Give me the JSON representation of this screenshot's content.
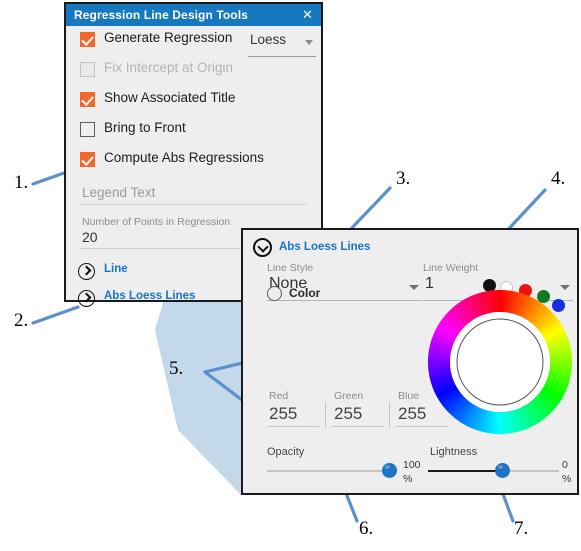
{
  "panel1": {
    "title": "Regression Line Design Tools",
    "close_icon": "close-icon",
    "checkboxes": [
      {
        "label": "Generate Regression",
        "checked": true,
        "disabled": false
      },
      {
        "label": "Fix Intercept at Origin",
        "checked": false,
        "disabled": true
      },
      {
        "label": "Show Associated Title",
        "checked": true,
        "disabled": false
      },
      {
        "label": "Bring to Front",
        "checked": false,
        "disabled": false
      },
      {
        "label": "Compute Abs Regressions",
        "checked": true,
        "disabled": false
      }
    ],
    "regression_type": {
      "value": "Loess",
      "caret_icon": "chevron-down-icon"
    },
    "legend_text": {
      "placeholder": "Legend Text",
      "value": ""
    },
    "num_points": {
      "label": "Number of Points in Regression",
      "value": "20"
    },
    "expanders": [
      {
        "label": "Line",
        "icon": "chevron-right-circle-icon"
      },
      {
        "label": "Abs Loess Lines",
        "icon": "chevron-right-circle-icon"
      }
    ]
  },
  "panel2": {
    "header": {
      "label": "Abs Loess Lines",
      "icon": "chevron-down-circle-icon"
    },
    "line_style": {
      "label": "Line Style",
      "value": "None",
      "caret_icon": "chevron-down-icon"
    },
    "line_weight": {
      "label": "Line Weight",
      "value": "1",
      "caret_icon": "chevron-down-icon"
    },
    "color_radio": {
      "label": "Color",
      "selected": false
    },
    "swatches": [
      {
        "name": "swatch-black",
        "color": "#111111"
      },
      {
        "name": "swatch-white",
        "color": "#ffffff"
      },
      {
        "name": "swatch-red",
        "color": "#ee1111"
      },
      {
        "name": "swatch-green",
        "color": "#0f7a23"
      },
      {
        "name": "swatch-blue",
        "color": "#1530e0"
      }
    ],
    "rgb": [
      {
        "label": "Red",
        "value": "255"
      },
      {
        "label": "Green",
        "value": "255"
      },
      {
        "label": "Blue",
        "value": "255"
      }
    ],
    "opacity": {
      "label": "Opacity",
      "value": "100",
      "unit": "%",
      "percent": 100
    },
    "lightness": {
      "label": "Lightness",
      "value": "0",
      "unit": "%",
      "percent": 48
    },
    "color_wheel": {
      "name": "hue-color-wheel",
      "selected_hue_deg": 35
    }
  },
  "annotations": [
    {
      "id": "1",
      "label": "1."
    },
    {
      "id": "2",
      "label": "2."
    },
    {
      "id": "3",
      "label": "3."
    },
    {
      "id": "4",
      "label": "4."
    },
    {
      "id": "5",
      "label": "5."
    },
    {
      "id": "6",
      "label": "6."
    },
    {
      "id": "7",
      "label": "7."
    }
  ],
  "colors": {
    "title_bar": "#1678be",
    "accent_checkbox": "#f2682a",
    "link_blue": "#1873c4",
    "annotation_arrow": "#5b90cd",
    "connector_fill": "#b9d1e8",
    "panel_bg": "#eeeeee"
  }
}
